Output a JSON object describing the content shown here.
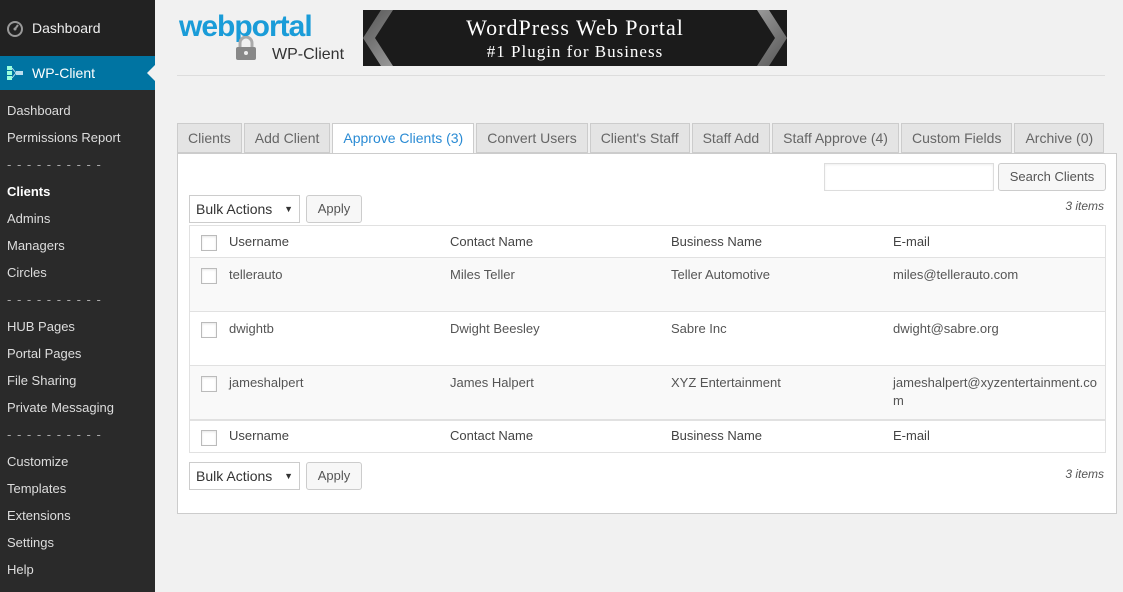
{
  "sidebar": {
    "dashboard_label": "Dashboard",
    "plugin_label": "WP-Client",
    "items": [
      {
        "label": "Dashboard"
      },
      {
        "label": "Permissions Report"
      },
      {
        "label": "- - - - - - - - - -"
      },
      {
        "label": "Clients"
      },
      {
        "label": "Admins"
      },
      {
        "label": "Managers"
      },
      {
        "label": "Circles"
      },
      {
        "label": "- - - - - - - - - -"
      },
      {
        "label": "HUB Pages"
      },
      {
        "label": "Portal Pages"
      },
      {
        "label": "File Sharing"
      },
      {
        "label": "Private Messaging"
      },
      {
        "label": "- - - - - - - - - -"
      },
      {
        "label": "Customize"
      },
      {
        "label": "Templates"
      },
      {
        "label": "Extensions"
      },
      {
        "label": "Settings"
      },
      {
        "label": "Help"
      }
    ]
  },
  "header": {
    "logo_main": "webportal",
    "logo_sub": "WP-Client",
    "banner_line1": "WordPress Web Portal",
    "banner_line2": "#1 Plugin for Business"
  },
  "tabs": [
    {
      "label": "Clients"
    },
    {
      "label": "Add Client"
    },
    {
      "label": "Approve Clients (3)"
    },
    {
      "label": "Convert Users"
    },
    {
      "label": "Client's Staff"
    },
    {
      "label": "Staff Add"
    },
    {
      "label": "Staff Approve (4)"
    },
    {
      "label": "Custom Fields"
    },
    {
      "label": "Archive (0)"
    }
  ],
  "search": {
    "value": "",
    "button_label": "Search Clients"
  },
  "bulk": {
    "label": "Bulk Actions",
    "apply_label": "Apply",
    "count_label": "3 items"
  },
  "table": {
    "columns": [
      "Username",
      "Contact Name",
      "Business Name",
      "E-mail"
    ],
    "rows": [
      {
        "username": "tellerauto",
        "contact": "Miles Teller",
        "business": "Teller Automotive",
        "email": "miles@tellerauto.com"
      },
      {
        "username": "dwightb",
        "contact": "Dwight Beesley",
        "business": "Sabre Inc",
        "email": "dwight@sabre.org"
      },
      {
        "username": "jameshalpert",
        "contact": "James Halpert",
        "business": "XYZ Entertainment",
        "email": "jameshalpert@xyzentertainment.com"
      }
    ]
  },
  "colors": {
    "sidebar_bg": "#222222",
    "active_menu": "#0074a2",
    "active_tab_text": "#2a8bd4"
  }
}
